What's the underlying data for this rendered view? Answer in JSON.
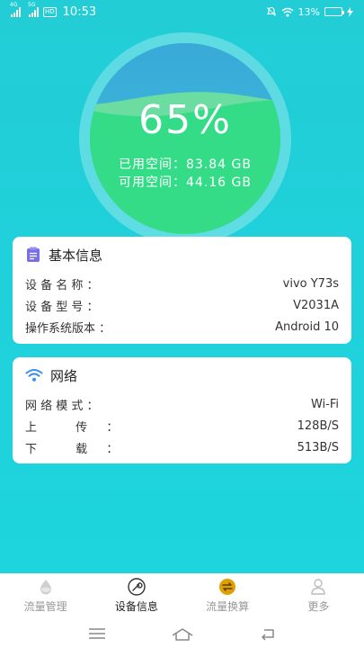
{
  "status_bar": {
    "time": "10:53",
    "signal1": "4G",
    "signal2": "5G",
    "hd": "HD",
    "battery_text": "13%",
    "battery_level": 0.13
  },
  "gauge": {
    "percent_text": "65%",
    "used_percent": 65,
    "used_line": "已用空间：83.84 GB",
    "free_line": "可用空间：44.16 GB",
    "colors": {
      "fill": "#35dc88",
      "water": "#3ab6d9"
    }
  },
  "basic_info": {
    "title": "基本信息",
    "rows": [
      {
        "label": "设 备 名 称 ：",
        "value": "vivo Y73s"
      },
      {
        "label": "设 备 型 号 ：",
        "value": "V2031A"
      },
      {
        "label": "操作系统版本 ：",
        "value": "Android 10"
      }
    ]
  },
  "network": {
    "title": "网络",
    "rows": [
      {
        "label": "网 络 模 式 ：",
        "value": "Wi-Fi"
      },
      {
        "label": "上　　　 传 　 ：",
        "value": "128B/S"
      },
      {
        "label": "下　　　 载 　 ：",
        "value": "513B/S"
      }
    ]
  },
  "bottom_nav": {
    "items": [
      {
        "label": "流量管理",
        "icon": "drop-icon"
      },
      {
        "label": "设备信息",
        "icon": "wrench-icon",
        "active": true
      },
      {
        "label": "流量换算",
        "icon": "exchange-icon"
      },
      {
        "label": "更多",
        "icon": "person-icon"
      }
    ]
  },
  "colors": {
    "accent": "#22cdd6",
    "card_bg": "#ffffff",
    "active_icon": "#e0a000",
    "wifi": "#3b8fe8",
    "doc": "#7a6ee8"
  }
}
